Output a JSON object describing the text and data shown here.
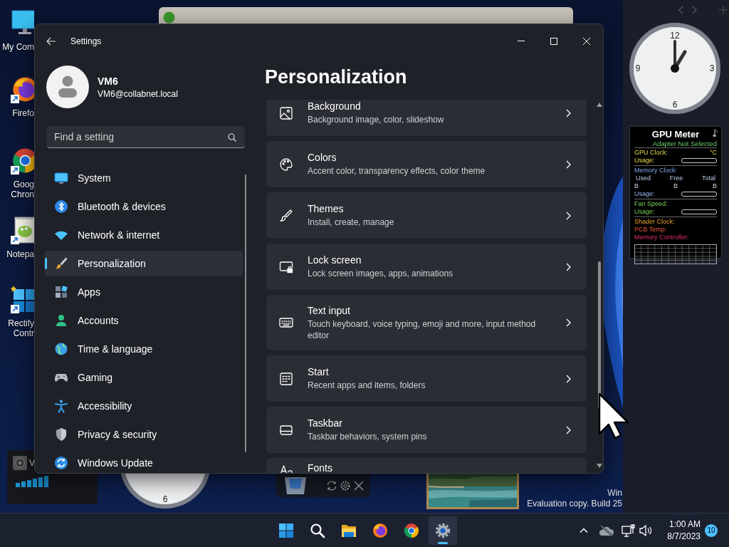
{
  "desktop_icons": [
    {
      "kind": "monitor",
      "label": [
        "My Com"
      ],
      "shortcut": false
    },
    {
      "kind": "firefox",
      "label": [
        "Firefo"
      ],
      "shortcut": true
    },
    {
      "kind": "chrome",
      "label": [
        "Goog",
        "Chron"
      ],
      "shortcut": true
    },
    {
      "kind": "notepad",
      "label": [
        "Notepa"
      ],
      "shortcut": true
    },
    {
      "kind": "tiles",
      "label": [
        "Rectify",
        "Contr"
      ],
      "shortcut": true
    }
  ],
  "clock_gadget": {
    "numerals": [
      "12",
      "3",
      "6",
      "9"
    ]
  },
  "gpu_meter": {
    "title": "GPU Meter",
    "status": "Adapter Not Selected",
    "sections": [
      {
        "rows": [
          {
            "kind": "pair",
            "label": "GPU Clock:",
            "value": "°C"
          },
          {
            "kind": "usage",
            "label": "Usage:",
            "level": 0
          }
        ]
      },
      {
        "rows": [
          {
            "kind": "label",
            "label": "Memory Clock:"
          },
          {
            "kind": "columns",
            "cells": [
              "Used",
              "Free",
              "Total"
            ]
          },
          {
            "kind": "columns",
            "cells": [
              "B",
              "B",
              "B"
            ]
          },
          {
            "kind": "usage",
            "label": "Usage:",
            "level": 0
          }
        ]
      },
      {
        "rows": [
          {
            "kind": "label",
            "label": "Fan Speed:"
          },
          {
            "kind": "usage",
            "label": "Usage:",
            "level": 0
          }
        ]
      },
      {
        "rows": [
          {
            "kind": "label",
            "label": "Shader Clock:"
          },
          {
            "kind": "label",
            "label": "PCB Temp:"
          },
          {
            "kind": "label",
            "label": "Memory Controller:"
          }
        ]
      }
    ]
  },
  "volume_gadget": {
    "label": "V"
  },
  "bottom_clock": {
    "numeral": "6"
  },
  "settings": {
    "title": "Settings",
    "user": {
      "name": "VM6",
      "email": "VM6@collabnet.local"
    },
    "search": {
      "placeholder": "Find a setting"
    },
    "nav": [
      {
        "kind": "system",
        "label": "System",
        "selected": false
      },
      {
        "kind": "bluetooth",
        "label": "Bluetooth & devices",
        "selected": false
      },
      {
        "kind": "network",
        "label": "Network & internet",
        "selected": false
      },
      {
        "kind": "personalization",
        "label": "Personalization",
        "selected": true
      },
      {
        "kind": "apps",
        "label": "Apps",
        "selected": false
      },
      {
        "kind": "accounts",
        "label": "Accounts",
        "selected": false
      },
      {
        "kind": "time",
        "label": "Time & language",
        "selected": false
      },
      {
        "kind": "gaming",
        "label": "Gaming",
        "selected": false
      },
      {
        "kind": "accessibility",
        "label": "Accessibility",
        "selected": false
      },
      {
        "kind": "privacy",
        "label": "Privacy & security",
        "selected": false
      },
      {
        "kind": "update",
        "label": "Windows Update",
        "selected": false
      }
    ],
    "page_title": "Personalization",
    "cards": [
      {
        "kind": "background",
        "title": "Background",
        "subtitle": "Background image, color, slideshow"
      },
      {
        "kind": "colors",
        "title": "Colors",
        "subtitle": "Accent color, transparency effects, color theme"
      },
      {
        "kind": "themes",
        "title": "Themes",
        "subtitle": "Install, create, manage"
      },
      {
        "kind": "lock",
        "title": "Lock screen",
        "subtitle": "Lock screen images, apps, animations"
      },
      {
        "kind": "keyboard",
        "title": "Text input",
        "subtitle": "Touch keyboard, voice typing, emoji and more, input method editor"
      },
      {
        "kind": "start",
        "title": "Start",
        "subtitle": "Recent apps and items, folders"
      },
      {
        "kind": "taskbar",
        "title": "Taskbar",
        "subtitle": "Taskbar behaviors, system pins"
      },
      {
        "kind": "fonts",
        "title": "Fonts"
      }
    ]
  },
  "desktop_notice": [
    "Win",
    "Evaluation copy. Build 25"
  ],
  "taskbar": {
    "apps": [
      {
        "kind": "start",
        "active": false
      },
      {
        "kind": "search",
        "active": false
      },
      {
        "kind": "folder",
        "active": false
      },
      {
        "kind": "firefox",
        "active": false
      },
      {
        "kind": "chrome",
        "active": false
      },
      {
        "kind": "settings",
        "active": true
      }
    ],
    "time": "1:00 AM",
    "date": "8/7/2023",
    "notifications": "10"
  }
}
